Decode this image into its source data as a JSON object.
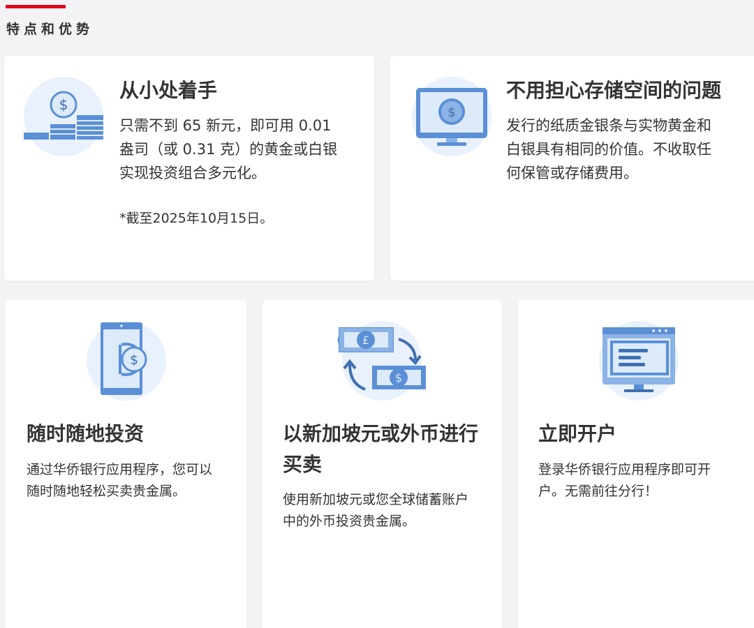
{
  "section": {
    "title": "特点和优势"
  },
  "colors": {
    "accent": "#e3051b",
    "icon_blue_light": "#dceafa",
    "icon_blue": "#5b8fd6",
    "icon_blue_dark": "#3f6fb0",
    "card_bg": "#ffffff",
    "page_bg": "#f3f3f5"
  },
  "cards": [
    {
      "icon": "coin-stacks-icon",
      "title": "从小处着手",
      "desc_lines": [
        "只需不到 65 新元，即可用 0.01",
        "盎司（或 0.31 克）的黄金或白银",
        "实现投资组合多元化。"
      ],
      "note": "*截至2025年10月15日。"
    },
    {
      "icon": "monitor-dollar-icon",
      "title": "不用担心存储空间的问题",
      "desc_lines": [
        "发行的纸质金银条与实物黄金和",
        "白银具有相同的价值。不收取任",
        "何保管或存储费用。"
      ]
    },
    {
      "icon": "phone-dollar-icon",
      "title": "随时随地投资",
      "desc_lines": [
        "通过华侨银行应用程序，您可以",
        "随时随地轻松买卖贵金属。"
      ]
    },
    {
      "icon": "currency-exchange-icon",
      "title_lines": [
        "以新加坡元或外币进行",
        "买卖"
      ],
      "desc_lines": [
        "使用新加坡元或您全球储蓄账户",
        "中的外币投资贵金属。"
      ]
    },
    {
      "icon": "desktop-app-icon",
      "title": "立即开户",
      "desc_lines": [
        "登录华侨银行应用程序即可开",
        "户。无需前往分行！"
      ]
    }
  ]
}
